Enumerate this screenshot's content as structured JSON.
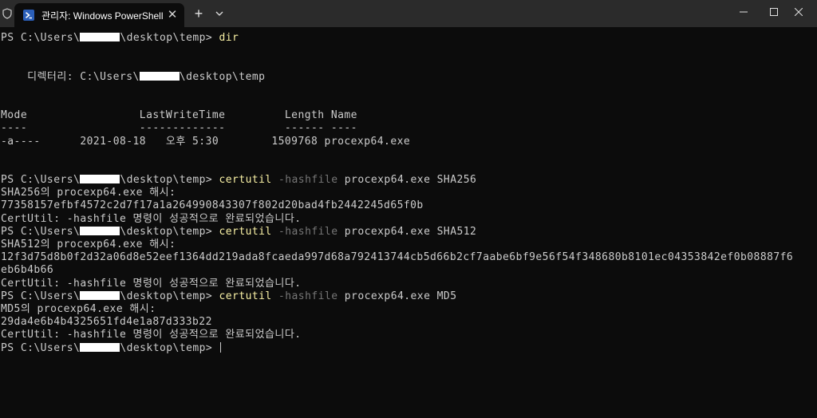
{
  "window": {
    "tab_title": "관리자: Windows PowerShell",
    "new_tab_label": "+",
    "close_glyph": "✕"
  },
  "colors": {
    "command": "#f9f1a5",
    "parameter": "#767676",
    "text": "#cccccc",
    "background": "#0c0c0c",
    "titlebar": "#2b2b2b",
    "ps_icon": "#2b5fb9"
  },
  "terminal": {
    "prompt_prefix": "PS C:\\Users\\",
    "prompt_suffix": "\\desktop\\temp> ",
    "cmd1": "dir",
    "directory_label": "    디렉터리: C:\\Users\\",
    "directory_suffix": "\\desktop\\temp",
    "table_header": "Mode                 LastWriteTime         Length Name",
    "table_rule": "----                 -------------         ------ ----",
    "table_row": "-a----      2021-08-18   오후 5:30        1509768 procexp64.exe",
    "certutil": "certutil",
    "hashfile_flag": " -hashfile",
    "args_sha256": " procexp64.exe SHA256",
    "hash_label_sha256": "SHA256의 procexp64.exe 해시:",
    "hash_sha256": "77358157efbf4572c2d7f17a1a264990843307f802d20bad4fb2442245d65f0b",
    "success": "CertUtil: -hashfile 명령이 성공적으로 완료되었습니다.",
    "args_sha512": " procexp64.exe SHA512",
    "hash_label_sha512": "SHA512의 procexp64.exe 해시:",
    "hash_sha512_line1": "12f3d75d8b0f2d32a06d8e52eef1364dd219ada8fcaeda997d68a792413744cb5d66b2cf7aabe6bf9e56f54f348680b8101ec04353842ef0b08887f6",
    "hash_sha512_line2": "eb6b4b66",
    "args_md5": " procexp64.exe MD5",
    "hash_label_md5": "MD5의 procexp64.exe 해시:",
    "hash_md5": "29da4e6b4b4325651fd4e1a87d333b22"
  }
}
